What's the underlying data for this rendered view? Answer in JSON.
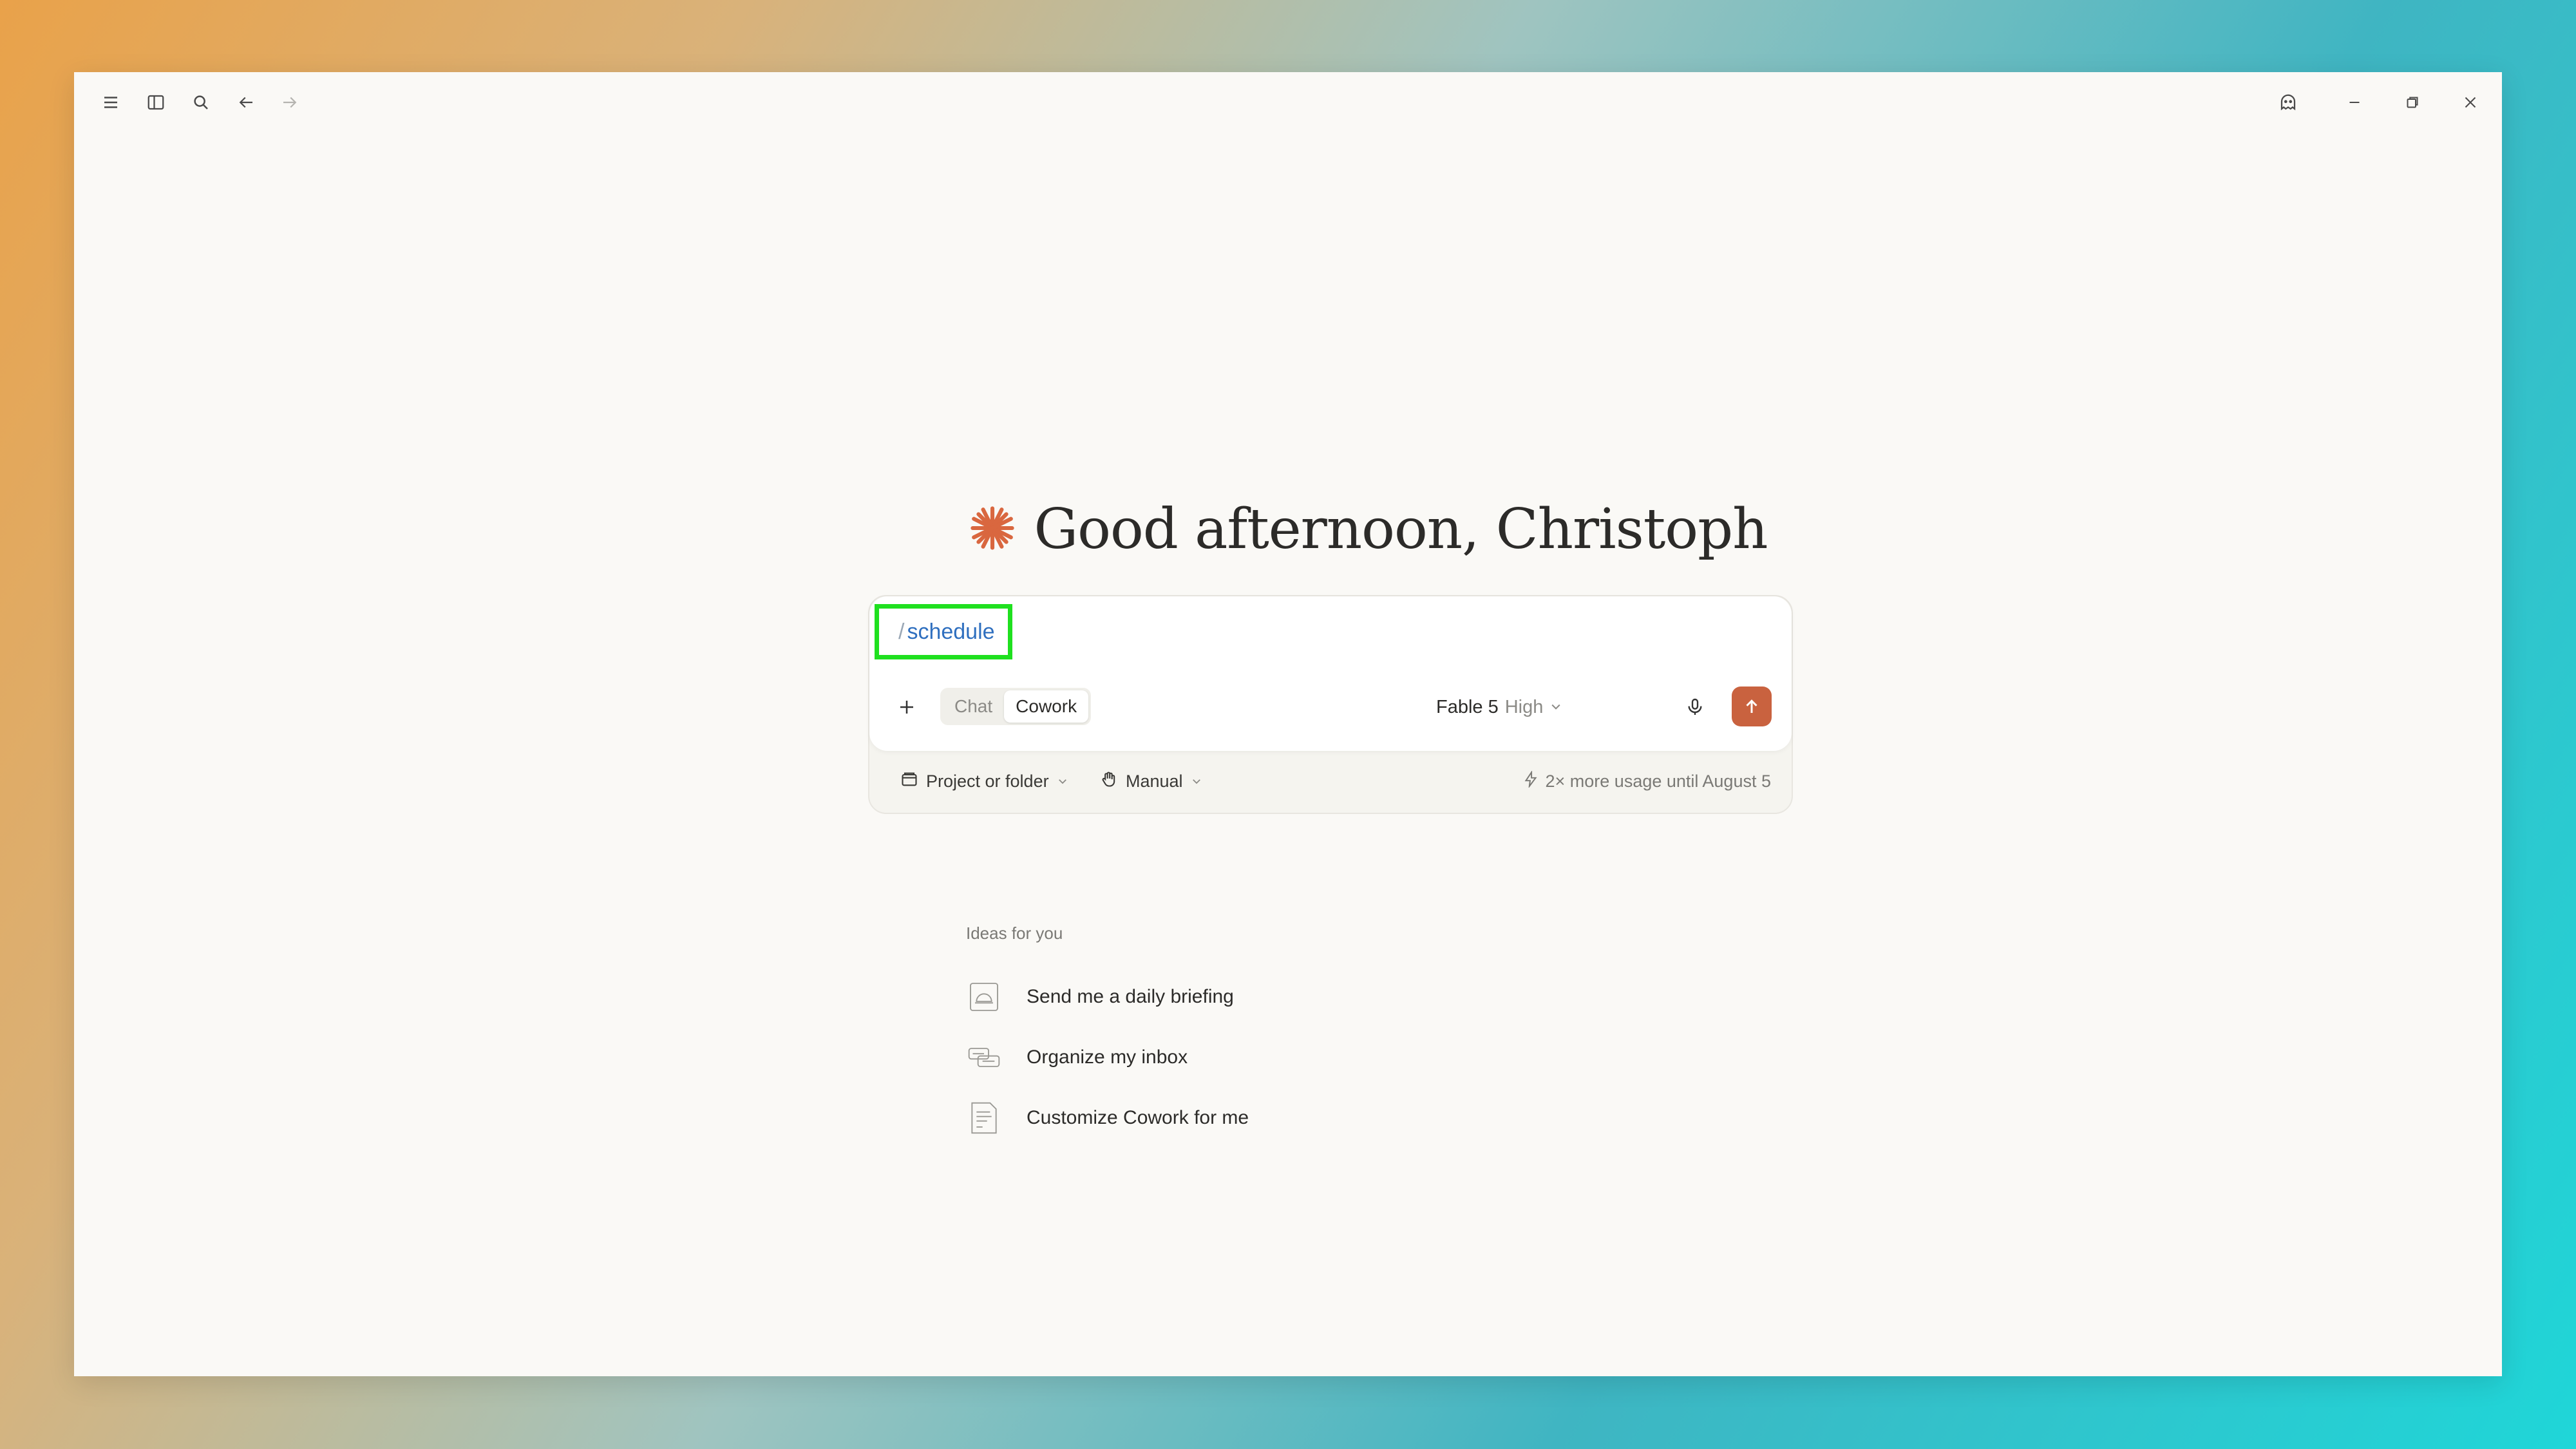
{
  "titlebar": {
    "left_icons": [
      "menu-icon",
      "sidebar-toggle-icon",
      "search-icon",
      "back-arrow-icon",
      "forward-arrow-icon"
    ],
    "right_icons": [
      "ghost-icon",
      "minimize-icon",
      "restore-icon",
      "close-icon"
    ]
  },
  "greeting": {
    "text": "Good afternoon, Christoph",
    "icon": "spark-logo-icon",
    "icon_color": "#d9673f"
  },
  "composer": {
    "input_slash": "/",
    "input_command": "schedule",
    "modes": [
      "Chat",
      "Cowork"
    ],
    "active_mode": "Cowork",
    "model_name": "Fable 5",
    "effort_level": "High",
    "send_color": "#c9623f"
  },
  "footer": {
    "project_label": "Project or folder",
    "permission_label": "Manual",
    "usage_text": "2× more usage until August 5"
  },
  "ideas": {
    "title": "Ideas for you",
    "items": [
      {
        "label": "Send me a daily briefing",
        "icon": "briefing-icon"
      },
      {
        "label": "Organize my inbox",
        "icon": "inbox-icon"
      },
      {
        "label": "Customize Cowork for me",
        "icon": "document-icon"
      }
    ]
  },
  "highlight_color": "#1fe01f"
}
